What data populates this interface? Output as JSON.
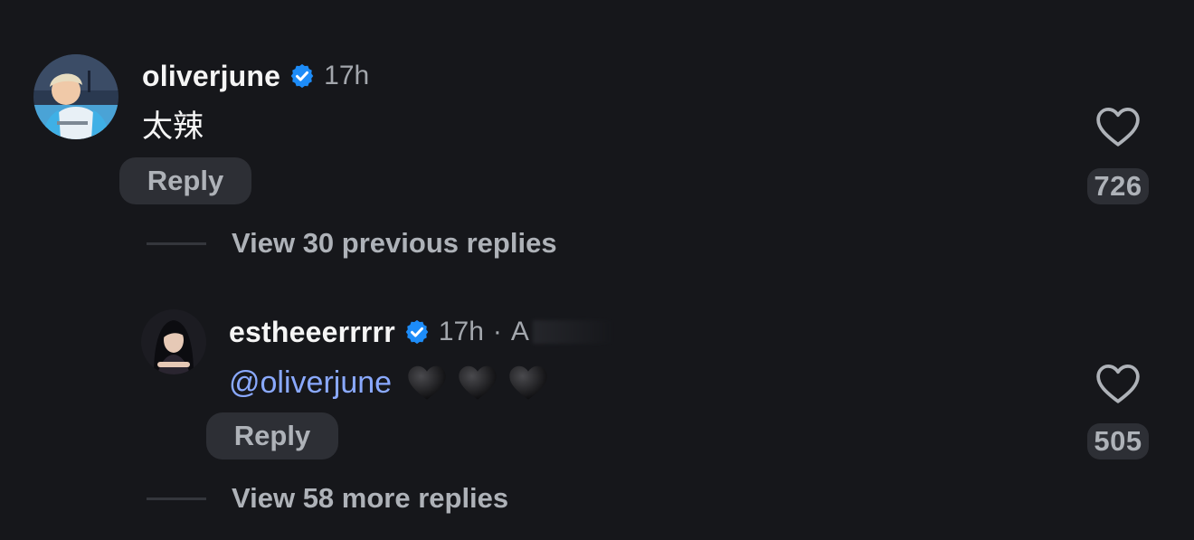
{
  "comments": [
    {
      "username": "oliverjune",
      "verified": true,
      "time": "17h",
      "text": "太辣",
      "reply_label": "Reply",
      "likes": "726",
      "avatar_icon": "avatar-oliverjune",
      "like_icon": "heart-outline-icon"
    },
    {
      "username": "estheeerrrrr",
      "verified": true,
      "time": "17h",
      "separator": "·",
      "location_partial": "A",
      "mention": "@oliverjune",
      "emoji_count": 3,
      "emoji_icon": "black-heart-icon",
      "reply_label": "Reply",
      "likes": "505",
      "avatar_icon": "avatar-estheeerrrrr",
      "like_icon": "heart-outline-icon"
    }
  ],
  "threads": {
    "previous_label": "View 30 previous replies",
    "more_label": "View 58 more replies"
  },
  "colors": {
    "background": "#16171b",
    "verified_badge": "#1d8cf8",
    "mention": "#8aa9ff",
    "muted_text": "#aeb2b8",
    "pill_bg": "#2d2f35"
  }
}
